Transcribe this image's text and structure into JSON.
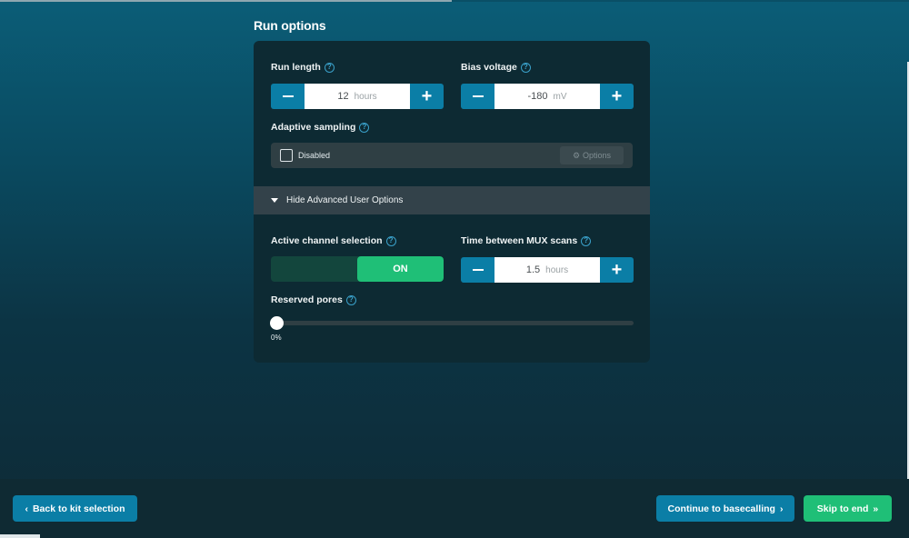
{
  "section_title": "Run options",
  "run_length": {
    "label": "Run length",
    "value": "12",
    "unit": "hours"
  },
  "bias_voltage": {
    "label": "Bias voltage",
    "value": "-180",
    "unit": "mV"
  },
  "adaptive_sampling": {
    "label": "Adaptive sampling",
    "state_label": "Disabled",
    "options_label": "Options",
    "checked": false
  },
  "advanced_toggle": {
    "label": "Hide Advanced User Options"
  },
  "active_channel": {
    "label": "Active channel selection",
    "state": "ON"
  },
  "mux_scans": {
    "label": "Time between MUX scans",
    "value": "1.5",
    "unit": "hours"
  },
  "reserved_pores": {
    "label": "Reserved pores",
    "value_label": "0%",
    "value": 0
  },
  "footer": {
    "back_label": "Back to kit selection",
    "continue_label": "Continue to basecalling",
    "skip_label": "Skip to end"
  },
  "colors": {
    "accent_blue": "#0b7ea6",
    "accent_green": "#1fbf77",
    "card_bg": "#0d2a33"
  },
  "icons": {
    "help": "question-circle-icon",
    "plus": "plus-icon",
    "minus": "minus-icon",
    "gear": "gear-icon",
    "chevron_down": "chevron-down-icon",
    "chevron_left": "chevron-left-icon",
    "chevron_right": "chevron-right-icon",
    "double_chevron_right": "double-chevron-right-icon"
  }
}
